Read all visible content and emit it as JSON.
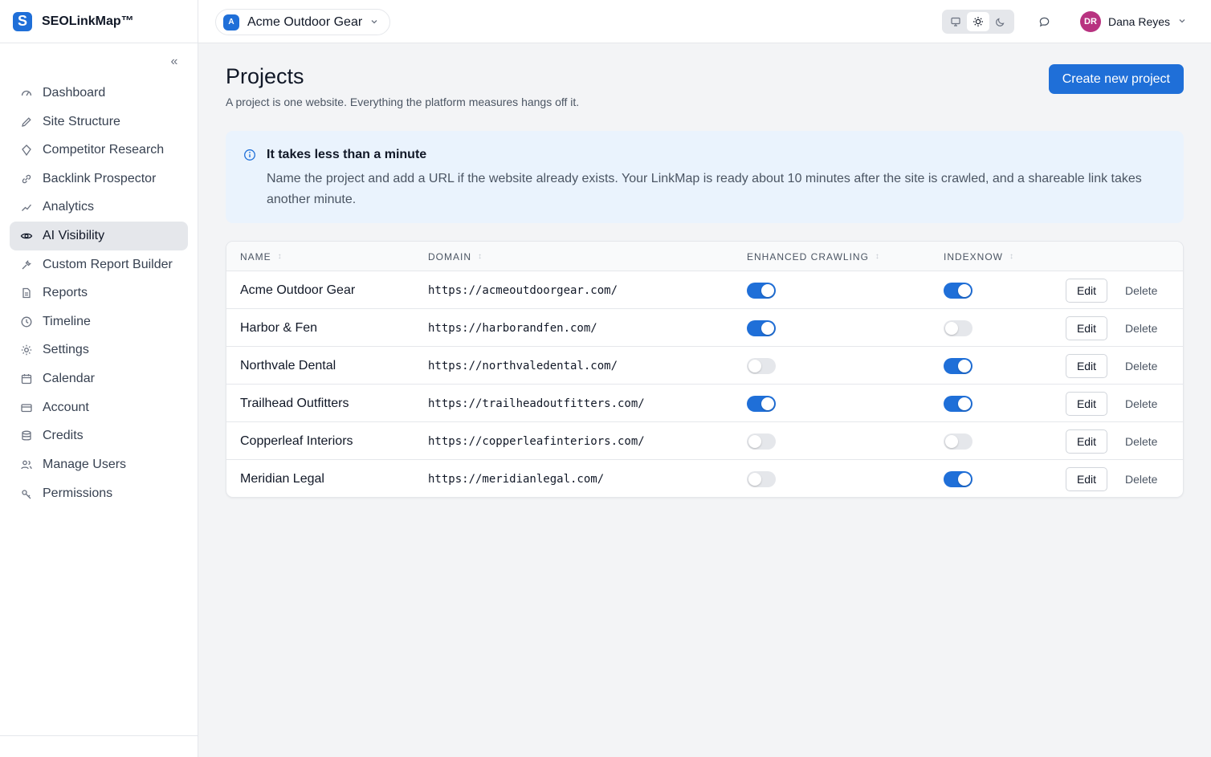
{
  "brand": {
    "name": "SEOLinkMap™",
    "logo_letter": "S"
  },
  "sidebar": {
    "collapse_label": "«",
    "items": [
      {
        "label": "Dashboard",
        "icon": "gauge-icon",
        "active": false
      },
      {
        "label": "Site Structure",
        "icon": "pencil-icon",
        "active": false
      },
      {
        "label": "Competitor Research",
        "icon": "target-icon",
        "active": false
      },
      {
        "label": "Backlink Prospector",
        "icon": "link-icon",
        "active": false
      },
      {
        "label": "Analytics",
        "icon": "trend-icon",
        "active": false
      },
      {
        "label": "AI Visibility",
        "icon": "eye-icon",
        "active": true
      },
      {
        "label": "Custom Report Builder",
        "icon": "tool-icon",
        "active": false
      },
      {
        "label": "Reports",
        "icon": "file-icon",
        "active": false
      },
      {
        "label": "Timeline",
        "icon": "clock-icon",
        "active": false
      },
      {
        "label": "Settings",
        "icon": "gear-icon",
        "active": false
      },
      {
        "label": "Calendar",
        "icon": "calendar-icon",
        "active": false
      },
      {
        "label": "Account",
        "icon": "card-icon",
        "active": false
      },
      {
        "label": "Credits",
        "icon": "database-icon",
        "active": false
      },
      {
        "label": "Manage Users",
        "icon": "users-icon",
        "active": false
      },
      {
        "label": "Permissions",
        "icon": "key-icon",
        "active": false
      }
    ]
  },
  "topbar": {
    "project": {
      "avatar": "A",
      "name": "Acme Outdoor Gear"
    },
    "theme_modes": [
      "system",
      "light",
      "dark"
    ],
    "theme_active": "light",
    "user": {
      "initials": "DR",
      "name": "Dana Reyes"
    }
  },
  "page": {
    "title": "Projects",
    "subtitle": "A project is one website. Everything the platform measures hangs off it.",
    "create_button": "Create new project"
  },
  "info": {
    "title": "It takes less than a minute",
    "text": "Name the project and add a URL if the website already exists. Your LinkMap is ready about 10 minutes after the site is crawled, and a shareable link takes another minute."
  },
  "table": {
    "columns": {
      "name": "NAME",
      "domain": "DOMAIN",
      "crawling": "ENHANCED CRAWLING",
      "indexnow": "INDEXNOW"
    },
    "edit_label": "Edit",
    "delete_label": "Delete",
    "rows": [
      {
        "name": "Acme Outdoor Gear",
        "domain": "https://acmeoutdoorgear.com/",
        "crawling": true,
        "indexnow": true
      },
      {
        "name": "Harbor & Fen",
        "domain": "https://harborandfen.com/",
        "crawling": true,
        "indexnow": false
      },
      {
        "name": "Northvale Dental",
        "domain": "https://northvaledental.com/",
        "crawling": false,
        "indexnow": true
      },
      {
        "name": "Trailhead Outfitters",
        "domain": "https://trailheadoutfitters.com/",
        "crawling": true,
        "indexnow": true
      },
      {
        "name": "Copperleaf Interiors",
        "domain": "https://copperleafinteriors.com/",
        "crawling": false,
        "indexnow": false
      },
      {
        "name": "Meridian Legal",
        "domain": "https://meridianlegal.com/",
        "crawling": false,
        "indexnow": true
      }
    ]
  },
  "colors": {
    "accent": "#1f6fd8",
    "info_bg": "#eaf3fd",
    "avatar_user": "#b83280"
  }
}
